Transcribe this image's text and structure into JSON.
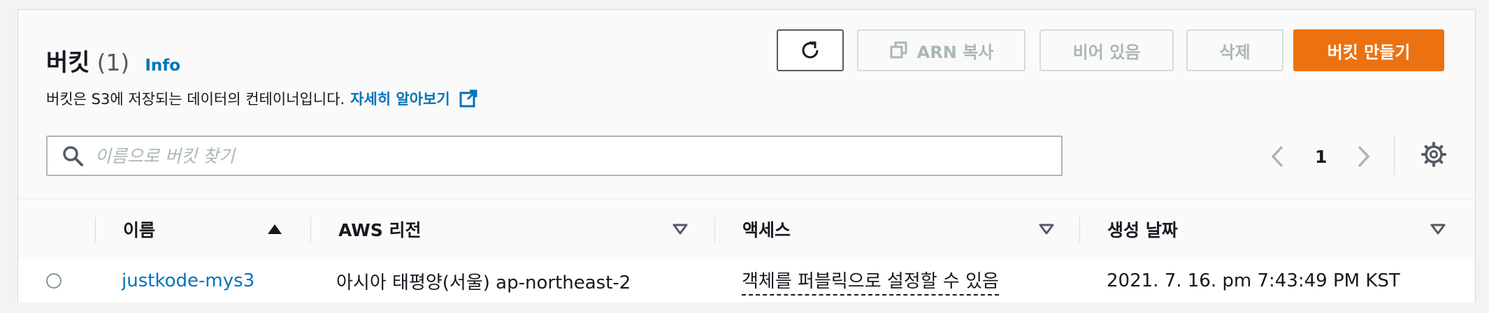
{
  "header": {
    "title": "버킷",
    "count": "(1)",
    "info_link": "Info",
    "description": "버킷은 S3에 저장되는 데이터의 컨테이너입니다.",
    "learn_more": "자세히 알아보기"
  },
  "toolbar": {
    "refresh_icon": "refresh-icon",
    "copy_arn_label": "ARN 복사",
    "empty_label": "비어 있음",
    "delete_label": "삭제",
    "create_label": "버킷 만들기"
  },
  "search": {
    "placeholder": "이름으로 버킷 찾기",
    "value": ""
  },
  "pagination": {
    "current_page": "1"
  },
  "table": {
    "columns": [
      {
        "label": "이름",
        "sort": "ascending"
      },
      {
        "label": "AWS 리전",
        "sort": "none"
      },
      {
        "label": "액세스",
        "sort": "none"
      },
      {
        "label": "생성 날짜",
        "sort": "none"
      }
    ],
    "rows": [
      {
        "selected": false,
        "name": "justkode-mys3",
        "region": "아시아 태평양(서울) ap-northeast-2",
        "access": "객체를 퍼블릭으로 설정할 수 있음",
        "created": "2021. 7. 16. pm 7:43:49 PM KST"
      }
    ]
  },
  "colors": {
    "primary": "#ec7211",
    "link": "#0073bb",
    "disabled": "#aab7b8"
  }
}
